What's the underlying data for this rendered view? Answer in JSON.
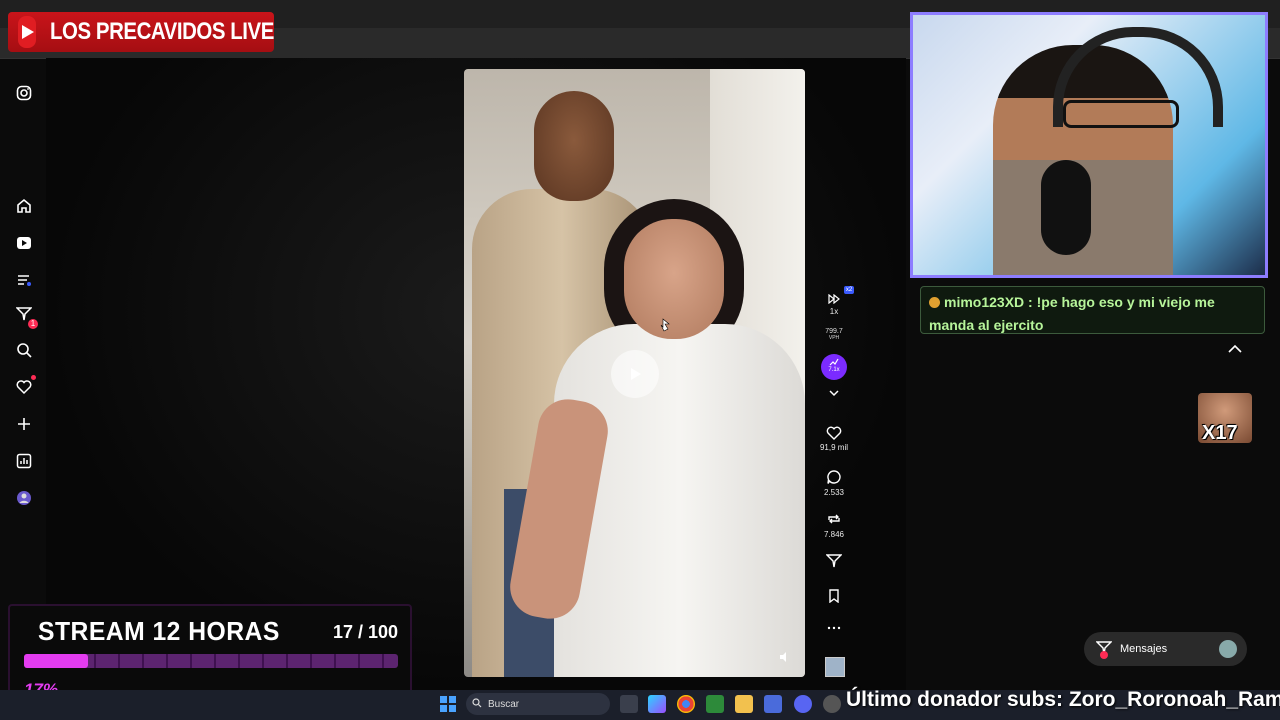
{
  "brand": {
    "title": "LOS PRECAVIDOS LIVE"
  },
  "left_rail": [
    {
      "name": "instagram-icon"
    },
    {
      "name": "home-icon"
    },
    {
      "name": "reels-icon"
    },
    {
      "name": "playlist-icon"
    },
    {
      "name": "inbox-icon",
      "badge": "1"
    },
    {
      "name": "search-icon"
    },
    {
      "name": "notifications-icon"
    },
    {
      "name": "create-icon"
    },
    {
      "name": "analytics-icon"
    },
    {
      "name": "profile-icon"
    }
  ],
  "video": {
    "speed": "1x",
    "speed_badge": "x2",
    "vph_value": "799.7",
    "vph_label": "VPH",
    "trend_value": "7.1x",
    "likes": "91,9 mil",
    "comments": "2.533",
    "reposts": "7.846"
  },
  "chat": {
    "username": "mimo123XD",
    "message": ": !pe hago eso y mi viejo me manda al ejercito"
  },
  "overlay": {
    "x17_label": "X17"
  },
  "messages": {
    "label": "Mensajes"
  },
  "goal": {
    "title": "STREAM 12 HORAS",
    "count": "17 / 100",
    "progress": 0.17,
    "percent": "17%"
  },
  "taskbar": {
    "search_placeholder": "Buscar",
    "ticker": "Último donador subs: Zoro_Roronoah_Ramos"
  },
  "colors": {
    "accent_purple": "#e33cf0",
    "webcam_border": "#8d7dff",
    "chat_green": "#b7f59a",
    "brand_red": "#c9141a"
  }
}
